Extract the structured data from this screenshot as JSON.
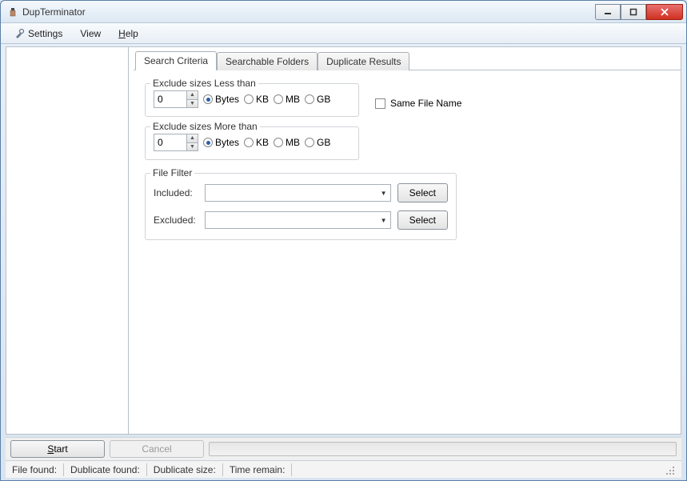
{
  "window": {
    "title": "DupTerminator"
  },
  "menu": {
    "settings": "Settings",
    "view": "View",
    "help": "Help"
  },
  "tabs": {
    "search_criteria": "Search Criteria",
    "searchable_folders": "Searchable Folders",
    "duplicate_results": "Duplicate Results"
  },
  "exclude_less": {
    "label": "Exclude sizes Less than",
    "value": "0",
    "units": {
      "bytes": "Bytes",
      "kb": "KB",
      "mb": "MB",
      "gb": "GB"
    },
    "selected": "bytes"
  },
  "exclude_more": {
    "label": "Exclude sizes More than",
    "value": "0",
    "units": {
      "bytes": "Bytes",
      "kb": "KB",
      "mb": "MB",
      "gb": "GB"
    },
    "selected": "bytes"
  },
  "same_file_name": {
    "label": "Same File Name",
    "checked": false
  },
  "file_filter": {
    "label": "File Filter",
    "included_label": "Included:",
    "included_value": "",
    "excluded_label": "Excluded:",
    "excluded_value": "",
    "select_button": "Select"
  },
  "buttons": {
    "start": "Start",
    "cancel": "Cancel"
  },
  "status": {
    "file_found": "File found:",
    "dublicate_found": "Dublicate found:",
    "dublicate_size": "Dublicate size:",
    "time_remain": "Time remain:"
  }
}
